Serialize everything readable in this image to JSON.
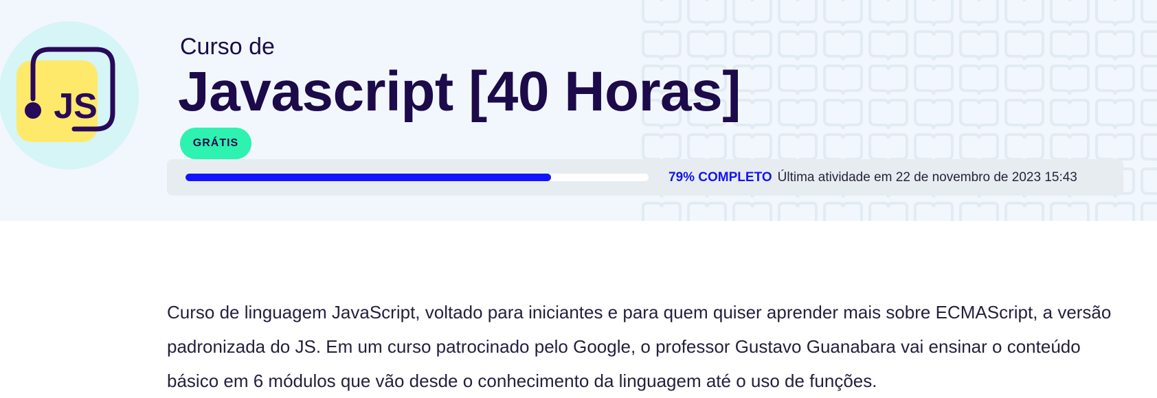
{
  "course": {
    "subtitle": "Curso de",
    "title": "Javascript [40 Horas]",
    "badge": "GRÁTIS",
    "logo_text": "JS",
    "logo_icon": "javascript-logo-icon"
  },
  "progress": {
    "percent": 79,
    "label": "79% COMPLETO",
    "last_activity": "Última atividade em 22 de novembro de 2023 15:43"
  },
  "description": "Curso de linguagem JavaScript, voltado para iniciantes e para quem quiser aprender mais sobre ECMAScript, a versão padronizada do JS. Em um curso patrocinado pelo Google, o professor Gustavo Guanabara vai ensinar o conteúdo básico em 6 módulos que vão desde o conhecimento da linguagem até o uso de funções.",
  "colors": {
    "hero_background": "#f1f7fc",
    "title": "#1c0a4a",
    "badge": "#2ef2b0",
    "progress_fill": "#1212ff",
    "logo_yellow": "#ffe96b",
    "logo_circle": "#d5f5f6"
  }
}
